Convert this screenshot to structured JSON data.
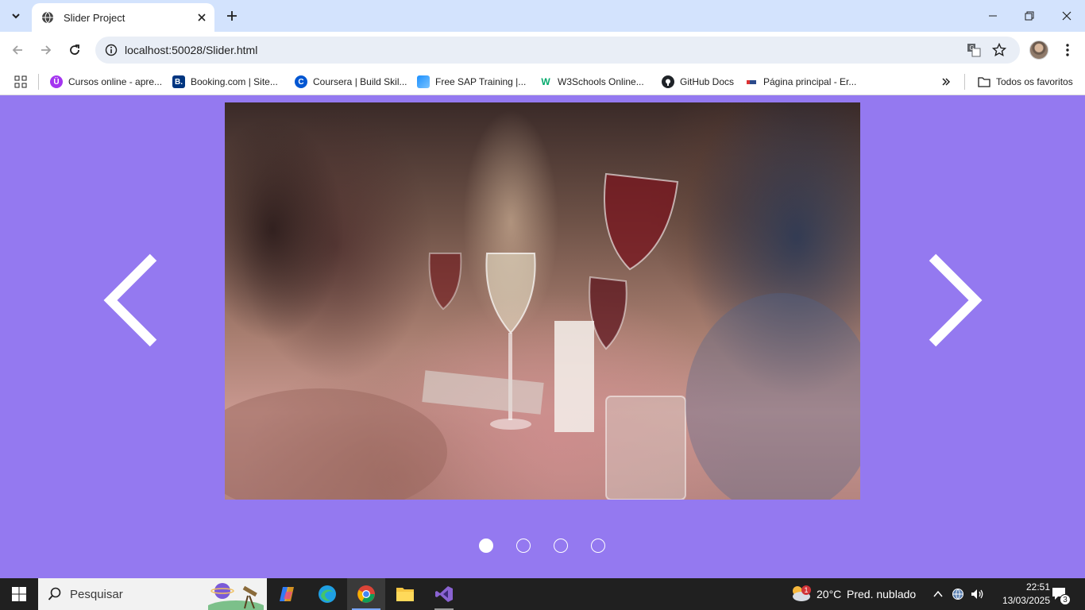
{
  "browser": {
    "tab_title": "Slider Project",
    "url": "localhost:50028/Slider.html"
  },
  "bookmarks": [
    {
      "label": "Cursos online - apre...",
      "icon": "udemy-icon",
      "color": "#a435f0"
    },
    {
      "label": "Booking.com | Site...",
      "icon": "booking-icon",
      "color": "#003580"
    },
    {
      "label": "Coursera | Build Skil...",
      "icon": "coursera-icon",
      "color": "#0056d2"
    },
    {
      "label": "Free SAP Training |...",
      "icon": "sap-icon",
      "color": "#1b90ff"
    },
    {
      "label": "W3Schools Online...",
      "icon": "w3schools-icon",
      "color": "#04aa6d"
    },
    {
      "label": "GitHub Docs",
      "icon": "github-icon",
      "color": "#1f2328"
    },
    {
      "label": "Página principal - Er...",
      "icon": "page-icon",
      "color": "#2b4a8b"
    }
  ],
  "bookmarks_folder": "Todos os favoritos",
  "slider": {
    "slide_count": 4,
    "active_index": 0,
    "image_description_icon": "photo-friends-toasting-wine"
  },
  "taskbar": {
    "search_placeholder": "Pesquisar",
    "weather_temp": "20°C",
    "weather_desc": "Pred. nublado",
    "weather_badge": "1",
    "time": "22:51",
    "date": "13/03/2025",
    "notification_count": "3"
  },
  "colors": {
    "page_background": "#9479f0",
    "tabstrip": "#d3e3fd",
    "taskbar": "#202020"
  }
}
